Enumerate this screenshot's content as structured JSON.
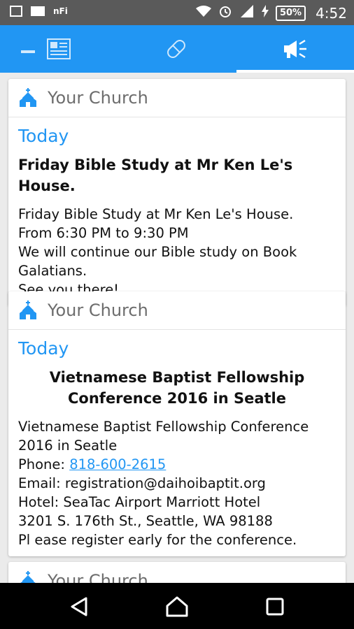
{
  "status_bar": {
    "battery": "50%",
    "time": "4:52",
    "nfc_label": "nFi"
  },
  "tabs": [
    {
      "icon": "news-icon",
      "selected": false
    },
    {
      "icon": "pill-icon",
      "selected": false
    },
    {
      "icon": "megaphone-icon",
      "selected": true
    }
  ],
  "feed": [
    {
      "church": "Your Church",
      "date": "Today",
      "title": "Friday Bible Study at Mr Ken Le's House.",
      "lines": [
        "Friday Bible Study at Mr Ken Le's House.",
        "From 6:30 PM to 9:30 PM",
        "We will continue our Bible study on Book",
        "Galatians.",
        "See you there!"
      ]
    },
    {
      "church": "Your Church",
      "date": "Today",
      "title_lines": [
        "Vietnamese Baptist Fellowship",
        "Conference 2016 in Seatle"
      ],
      "lines": [
        "Vietnamese Baptist Fellowship Conference",
        "2016 in Seatle"
      ],
      "phone_label": "Phone: ",
      "phone": "818-600-2615",
      "lines_after": [
        "Email: registration@daihoibaptit.org",
        "Hotel: SeaTac Airport Marriott Hotel",
        "3201 S. 176th St., Seattle, WA 98188",
        "Pl ease register early for the conference."
      ]
    },
    {
      "church": "Your Church"
    }
  ],
  "colors": {
    "accent": "#2196f3",
    "statusbar": "#5a5a5a",
    "navbar": "#000000"
  }
}
